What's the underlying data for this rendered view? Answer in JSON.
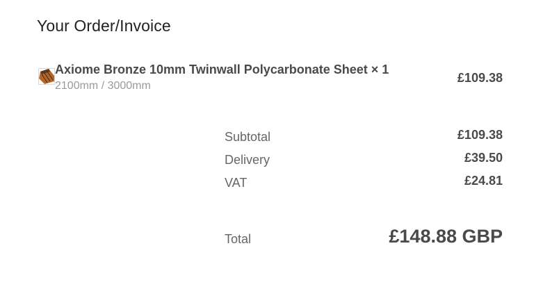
{
  "page": {
    "title": "Your Order/Invoice"
  },
  "line_items": [
    {
      "name": "Axiome Bronze 10mm Twinwall Polycarbonate Sheet × 1",
      "variant": "2100mm / 3000mm",
      "price": "£109.38",
      "thumbnail_icon": "polycarbonate-sheet-thumbnail"
    }
  ],
  "totals": {
    "subtotal_label": "Subtotal",
    "subtotal_value": "£109.38",
    "delivery_label": "Delivery",
    "delivery_value": "£39.50",
    "vat_label": "VAT",
    "vat_value": "£24.81",
    "total_label": "Total",
    "total_value": "£148.88 GBP"
  },
  "colors": {
    "heading": "#222222",
    "text_strong": "#4a4a4a",
    "text_muted": "#9a9a9a",
    "label": "#666666",
    "thumbnail_bronze": "#b8652a"
  }
}
